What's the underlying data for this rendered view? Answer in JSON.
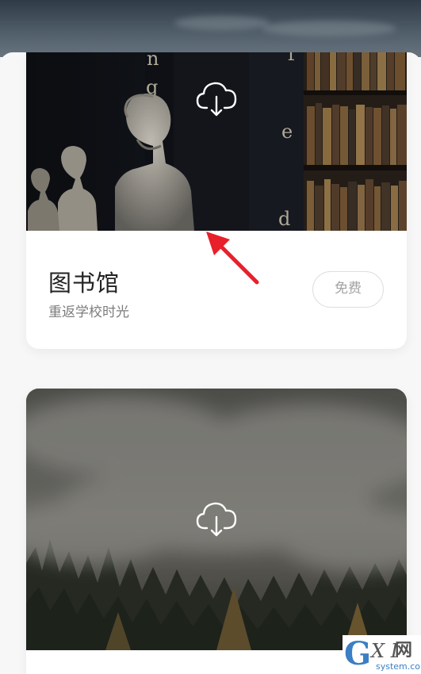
{
  "cards": [
    {
      "title": "图书馆",
      "subtitle": "重返学校时光",
      "price_label": "免费",
      "image_icon": "cloud-download-icon",
      "image_scene": "library bookshelves with marble busts",
      "book_letters": [
        "n",
        "g",
        "f",
        "e",
        "d"
      ]
    },
    {
      "image_icon": "cloud-download-icon",
      "image_scene": "misty forest"
    }
  ],
  "annotation": {
    "icon": "red-arrow-icon",
    "color": "#e8202a"
  },
  "watermark": {
    "letter_g": "G",
    "letters_xi": "X I",
    "chinese": "网",
    "domain": "system.com"
  },
  "colors": {
    "card_background": "#ffffff",
    "title_text": "#222222",
    "subtitle_text": "#7d7d7d",
    "price_border": "#dedede",
    "price_text": "#a3a3a3"
  }
}
